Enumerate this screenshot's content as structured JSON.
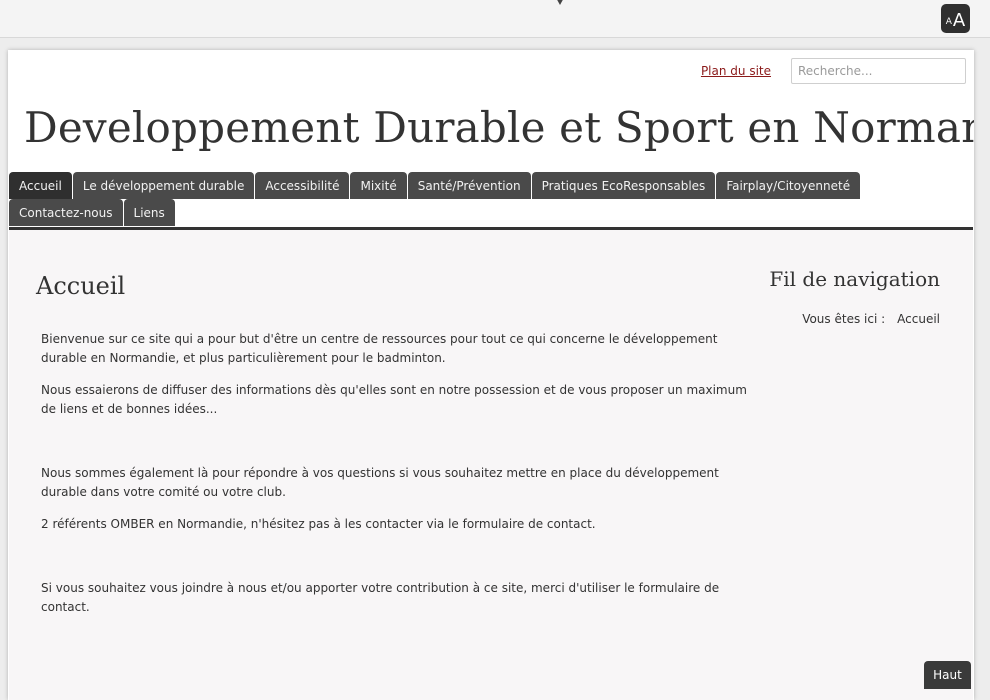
{
  "toolbar": {
    "text_size_small": "A",
    "text_size_large": "A"
  },
  "header": {
    "sitemap_label": "Plan du site",
    "search_placeholder": "Recherche...",
    "site_title": "Developpement Durable et Sport en Normandie"
  },
  "nav": {
    "items": [
      {
        "label": "Accueil",
        "active": true
      },
      {
        "label": "Le développement durable"
      },
      {
        "label": "Accessibilité"
      },
      {
        "label": "Mixité"
      },
      {
        "label": "Santé/Prévention"
      },
      {
        "label": "Pratiques EcoResponsables"
      },
      {
        "label": "Fairplay/Citoyenneté"
      },
      {
        "label": "Contactez-nous"
      },
      {
        "label": "Liens"
      }
    ]
  },
  "main": {
    "heading": "Accueil",
    "paragraphs": [
      "Bienvenue sur ce site qui a pour but d'être un centre de ressources pour tout ce qui concerne le développement durable en Normandie, et plus particulièrement pour le badminton.",
      "Nous essaierons de diffuser des informations dès qu'elles sont en notre possession et de vous proposer un maximum de liens et de bonnes idées...",
      "Nous sommes également là pour répondre à vos questions si vous souhaitez mettre en place du développement durable dans votre comité ou votre club.",
      "2 référents OMBER en Normandie, n'hésitez pas à les contacter via le formulaire de contact.",
      "Si vous souhaitez vous joindre à nous et/ou apporter votre contribution à ce site, merci d'utiliser le formulaire de contact."
    ]
  },
  "sidebar": {
    "heading": "Fil de navigation",
    "breadcrumb_prefix": "Vous êtes ici :",
    "breadcrumb_current": "Accueil"
  },
  "footer": {
    "back_to_top": "Haut"
  }
}
